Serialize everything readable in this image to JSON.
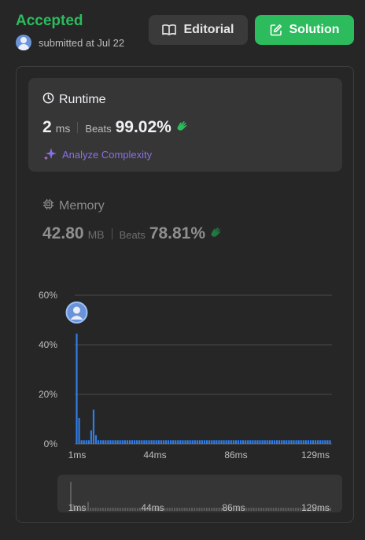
{
  "header": {
    "status": "Accepted",
    "submitted": "submitted at Jul 22",
    "editorial_label": "Editorial",
    "solution_label": "Solution"
  },
  "runtime": {
    "title": "Runtime",
    "value": "2",
    "unit": "ms",
    "beats_label": "Beats",
    "beats_pct": "99.02%",
    "analyze_label": "Analyze Complexity"
  },
  "memory": {
    "title": "Memory",
    "value": "42.80",
    "unit": "MB",
    "beats_label": "Beats",
    "beats_pct": "78.81%"
  },
  "colors": {
    "accent_green": "#2cbb5d",
    "bar_blue": "#2e7de9",
    "analyze_purple": "#8b6ee6"
  },
  "icons": {
    "editorial": "book-icon",
    "solution": "edit-icon",
    "runtime": "clock-icon",
    "memory": "chip-icon",
    "analyze": "sparkle-icon",
    "beats": "clap-icon"
  },
  "chart_data": {
    "type": "bar",
    "title": "",
    "xlabel": "",
    "ylabel": "",
    "ylim": [
      0,
      60
    ],
    "y_ticks": [
      "60%",
      "40%",
      "20%",
      "0%"
    ],
    "x_ticks": [
      "1ms",
      "44ms",
      "86ms",
      "129ms"
    ],
    "brush_ticks": [
      "1ms",
      "44ms",
      "86ms",
      "129ms"
    ],
    "user_marker_x": "2ms",
    "series": [
      {
        "values": [
          44.5,
          10.5,
          1.5,
          1.5,
          1.5,
          1.5,
          5.5,
          13.8,
          3.5,
          1.5,
          1.5,
          1.5,
          1.5,
          1.5,
          1.5,
          1.5,
          1.5,
          1.5,
          1.5,
          1.5,
          1.5,
          1.5,
          1.5,
          1.5,
          1.5,
          1.5,
          1.5,
          1.5,
          1.5,
          1.5,
          1.5,
          1.5,
          1.5,
          1.5,
          1.5,
          1.5,
          1.5,
          1.5,
          1.5,
          1.5,
          1.5,
          1.5,
          1.5,
          1.5,
          1.5,
          1.5,
          1.5,
          1.5,
          1.5,
          1.5,
          1.5,
          1.5,
          1.5,
          1.5,
          1.5,
          1.5,
          1.5,
          1.5,
          1.5,
          1.5,
          1.5,
          1.5,
          1.5,
          1.5,
          1.5,
          1.5,
          1.5,
          1.5,
          1.5,
          1.5,
          1.5,
          1.5,
          1.5,
          1.5,
          1.5,
          1.5,
          1.5,
          1.5,
          1.5,
          1.5,
          1.5,
          1.5,
          1.5,
          1.5,
          1.5,
          1.5,
          1.5,
          1.5,
          1.5,
          1.5,
          1.5,
          1.5,
          1.5,
          1.5,
          1.5,
          1.5,
          1.5,
          1.5,
          1.5,
          1.5,
          1.5,
          1.5,
          1.5,
          1.5,
          1.5,
          1.5
        ]
      }
    ]
  }
}
